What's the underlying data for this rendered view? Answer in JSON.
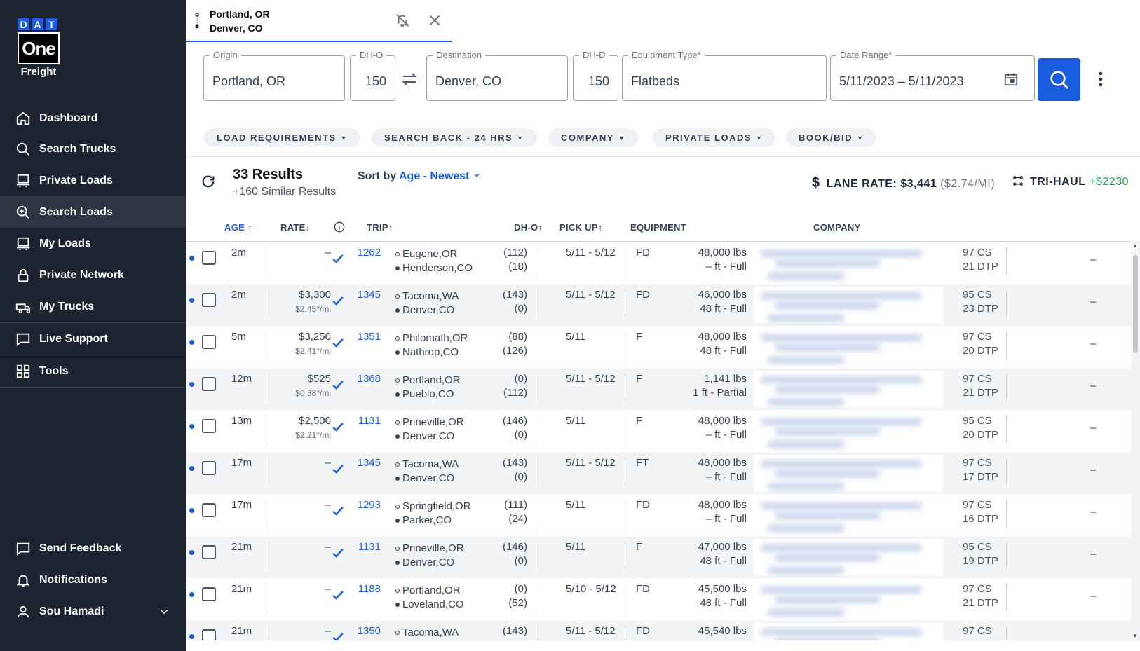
{
  "brand": {
    "dat": [
      "D",
      "A",
      "T"
    ],
    "one": "One",
    "freight": "Freight",
    "accent": "#1a5cdf"
  },
  "sidebar": {
    "items": [
      {
        "label": "Dashboard",
        "icon": "home-icon"
      },
      {
        "label": "Search Trucks",
        "icon": "search-icon"
      },
      {
        "label": "Private Loads",
        "icon": "truck-icon"
      },
      {
        "label": "Search Loads",
        "icon": "search-loads-icon",
        "active": true
      },
      {
        "label": "My Loads",
        "icon": "truck-icon"
      },
      {
        "label": "Private Network",
        "icon": "lock-icon"
      },
      {
        "label": "My Trucks",
        "icon": "truck-outline-icon"
      },
      {
        "label": "Live Support",
        "icon": "chat-icon"
      },
      {
        "label": "Tools",
        "icon": "grid-icon"
      }
    ],
    "bottom": {
      "feedback": "Send Feedback",
      "notifications": "Notifications",
      "user": "Sou Hamadi"
    }
  },
  "tab": {
    "origin": "Portland, OR",
    "destination": "Denver, CO"
  },
  "form": {
    "origin_label": "Origin",
    "origin_value": "Portland, OR",
    "dho_label": "DH-O",
    "dho_value": "150",
    "destination_label": "Destination",
    "destination_value": "Denver, CO",
    "dhd_label": "DH-D",
    "dhd_value": "150",
    "equipment_label": "Equipment Type*",
    "equipment_value": "Flatbeds",
    "date_label": "Date Range*",
    "date_value": "5/11/2023 – 5/11/2023"
  },
  "filters": [
    "LOAD REQUIREMENTS",
    "SEARCH BACK - 24 HRS",
    "COMPANY",
    "PRIVATE LOADS",
    "BOOK/BID"
  ],
  "results": {
    "count": "33 Results",
    "similar": "+160 Similar Results",
    "sort_prefix": "Sort by",
    "sort_value": "Age - Newest",
    "lane_rate_label": "LANE RATE: $3,441",
    "lane_rate_per_mile": "($2.74/MI)",
    "trihaul_label": "TRI-HAUL",
    "trihaul_value": "+$2230"
  },
  "columns": {
    "age": "AGE",
    "rate": "RATE",
    "trip": "TRIP",
    "dho": "DH-O",
    "pickup": "PICK UP",
    "equipment": "EQUIPMENT",
    "company": "COMPANY"
  },
  "rows": [
    {
      "age": "2m",
      "rate": "–",
      "rate_sub": "",
      "trip": "1262",
      "origin": "Eugene,OR",
      "dest": "Henderson,CO",
      "dho": "(112)",
      "dhd": "(18)",
      "pickup": "5/11 - 5/12",
      "eq": "FD",
      "weight": "48,000 lbs",
      "length": "– ft - Full",
      "cs": "97 CS",
      "dtp": "21 DTP",
      "extra": "–"
    },
    {
      "age": "2m",
      "rate": "$3,300",
      "rate_sub": "$2.45*/mi",
      "trip": "1345",
      "origin": "Tacoma,WA",
      "dest": "Denver,CO",
      "dho": "(143)",
      "dhd": "(0)",
      "pickup": "5/11 - 5/12",
      "eq": "FD",
      "weight": "46,000 lbs",
      "length": "48 ft - Full",
      "cs": "95 CS",
      "dtp": "23 DTP",
      "extra": "–"
    },
    {
      "age": "5m",
      "rate": "$3,250",
      "rate_sub": "$2.41*/mi",
      "trip": "1351",
      "origin": "Philomath,OR",
      "dest": "Nathrop,CO",
      "dho": "(88)",
      "dhd": "(126)",
      "pickup": "5/11",
      "eq": "F",
      "weight": "48,000 lbs",
      "length": "48 ft - Full",
      "cs": "97 CS",
      "dtp": "20 DTP",
      "extra": "–"
    },
    {
      "age": "12m",
      "rate": "$525",
      "rate_sub": "$0.38*/mi",
      "trip": "1368",
      "origin": "Portland,OR",
      "dest": "Pueblo,CO",
      "dho": "(0)",
      "dhd": "(112)",
      "pickup": "5/11 - 5/12",
      "eq": "F",
      "weight": "1,141 lbs",
      "length": "1 ft - Partial",
      "cs": "97 CS",
      "dtp": "21 DTP",
      "extra": "–"
    },
    {
      "age": "13m",
      "rate": "$2,500",
      "rate_sub": "$2.21*/mi",
      "trip": "1131",
      "origin": "Prineville,OR",
      "dest": "Denver,CO",
      "dho": "(146)",
      "dhd": "(0)",
      "pickup": "5/11",
      "eq": "F",
      "weight": "48,000 lbs",
      "length": "– ft - Full",
      "cs": "95 CS",
      "dtp": "20 DTP",
      "extra": "–"
    },
    {
      "age": "17m",
      "rate": "–",
      "rate_sub": "",
      "trip": "1345",
      "origin": "Tacoma,WA",
      "dest": "Denver,CO",
      "dho": "(143)",
      "dhd": "(0)",
      "pickup": "5/11 - 5/12",
      "eq": "FT",
      "weight": "48,000 lbs",
      "length": "– ft - Full",
      "cs": "97 CS",
      "dtp": "17 DTP",
      "extra": "–"
    },
    {
      "age": "17m",
      "rate": "–",
      "rate_sub": "",
      "trip": "1293",
      "origin": "Springfield,OR",
      "dest": "Parker,CO",
      "dho": "(111)",
      "dhd": "(24)",
      "pickup": "5/11",
      "eq": "FD",
      "weight": "48,000 lbs",
      "length": "– ft - Full",
      "cs": "97 CS",
      "dtp": "16 DTP",
      "extra": "–"
    },
    {
      "age": "21m",
      "rate": "–",
      "rate_sub": "",
      "trip": "1131",
      "origin": "Prineville,OR",
      "dest": "Denver,CO",
      "dho": "(146)",
      "dhd": "(0)",
      "pickup": "5/11",
      "eq": "F",
      "weight": "47,000 lbs",
      "length": "48 ft - Full",
      "cs": "95 CS",
      "dtp": "19 DTP",
      "extra": "–"
    },
    {
      "age": "21m",
      "rate": "–",
      "rate_sub": "",
      "trip": "1188",
      "origin": "Portland,OR",
      "dest": "Loveland,CO",
      "dho": "(0)",
      "dhd": "(52)",
      "pickup": "5/10 - 5/12",
      "eq": "FD",
      "weight": "45,500 lbs",
      "length": "48 ft - Full",
      "cs": "97 CS",
      "dtp": "21 DTP",
      "extra": "–"
    },
    {
      "age": "21m",
      "rate": "–",
      "rate_sub": "",
      "trip": "1350",
      "origin": "Tacoma,WA",
      "dest": "",
      "dho": "(143)",
      "dhd": "",
      "pickup": "5/11 - 5/12",
      "eq": "FD",
      "weight": "45,540 lbs",
      "length": "",
      "cs": "97 CS",
      "dtp": "",
      "extra": ""
    }
  ]
}
